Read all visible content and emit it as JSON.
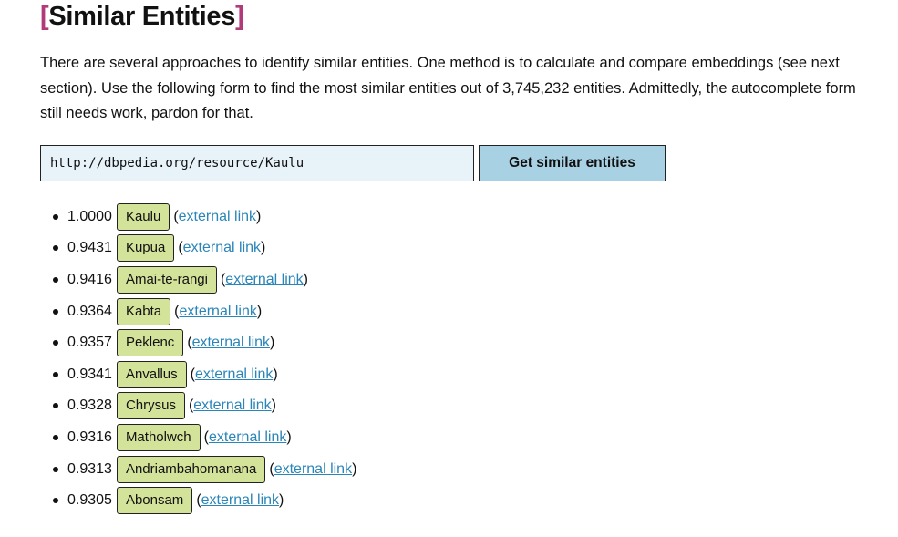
{
  "heading": {
    "bracket_open": "[",
    "text": "Similar Entities",
    "bracket_close": "]"
  },
  "intro": "There are several approaches to identify similar entities. One method is to calculate and compare embeddings (see next section). Use the following form to find the most similar entities out of 3,745,232 entities. Admittedly, the autocomplete form still needs work, pardon for that.",
  "form": {
    "input_value": "http://dbpedia.org/resource/Kaulu",
    "submit_label": "Get similar entities"
  },
  "results": [
    {
      "score": "1.0000",
      "entity": "Kaulu",
      "link_text": "external link"
    },
    {
      "score": "0.9431",
      "entity": "Kupua",
      "link_text": "external link"
    },
    {
      "score": "0.9416",
      "entity": "Amai-te-rangi",
      "link_text": "external link"
    },
    {
      "score": "0.9364",
      "entity": "Kabta",
      "link_text": "external link"
    },
    {
      "score": "0.9357",
      "entity": "Peklenc",
      "link_text": "external link"
    },
    {
      "score": "0.9341",
      "entity": "Anvallus",
      "link_text": "external link"
    },
    {
      "score": "0.9328",
      "entity": "Chrysus",
      "link_text": "external link"
    },
    {
      "score": "0.9316",
      "entity": "Matholwch",
      "link_text": "external link"
    },
    {
      "score": "0.9313",
      "entity": "Andriambahomanana",
      "link_text": "external link"
    },
    {
      "score": "0.9305",
      "entity": "Abonsam",
      "link_text": "external link"
    }
  ],
  "colors": {
    "bracket": "#b03a7a",
    "input_bg": "#e7f2f9",
    "button_bg": "#a9d1e4",
    "entity_bg": "#d4e39a",
    "link": "#2a86b8"
  }
}
